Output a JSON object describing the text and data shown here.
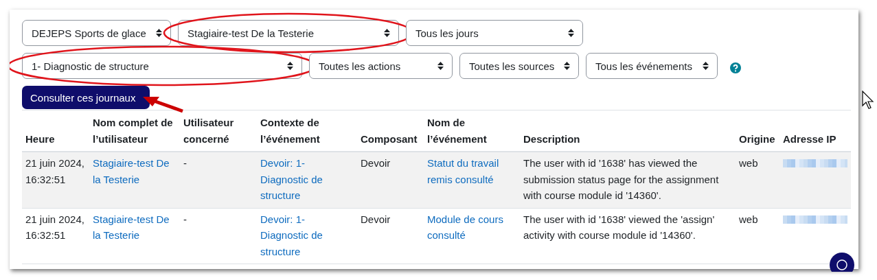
{
  "filters_row_1": [
    {
      "value": "DEJEPS Sports de glace",
      "highlighted": false
    },
    {
      "value": "Stagiaire-test De la Testerie",
      "highlighted": true
    },
    {
      "value": "Tous les jours",
      "highlighted": false
    }
  ],
  "filters_row_2": [
    {
      "value": "1- Diagnostic de structure",
      "highlighted": true
    },
    {
      "value": "Toutes les actions",
      "highlighted": false
    },
    {
      "value": "Toutes les sources",
      "highlighted": false
    },
    {
      "value": "Tous les événements",
      "highlighted": false
    }
  ],
  "submit_button": {
    "label": "Consulter ces journaux",
    "pointed_at": true
  },
  "table": {
    "columns": [
      "Heure",
      "Nom complet de l’utilisateur",
      "Utilisateur concerné",
      "Contexte de l’événement",
      "Composant",
      "Nom de l’événement",
      "Description",
      "Origine",
      "Adresse IP"
    ],
    "rows": [
      {
        "time": "21 juin 2024, 16:32:51",
        "user": "Stagiaire-test De la Testerie",
        "related_user": "-",
        "context": "Devoir: 1- Diagnostic de structure",
        "component": "Devoir",
        "event": "Statut du travail remis consulté",
        "description": "The user with id '1638' has viewed the submission status page for the assignment with course module id '14360'.",
        "origin": "web"
      },
      {
        "time": "21 juin 2024, 16:32:51",
        "user": "Stagiaire-test De la Testerie",
        "related_user": "-",
        "context": "Devoir: 1- Diagnostic de structure",
        "component": "Devoir",
        "event": "Module de cours consulté",
        "description": "The user with id '1638' viewed the 'assign' activity with course module id '14360'.",
        "origin": "web"
      }
    ]
  }
}
